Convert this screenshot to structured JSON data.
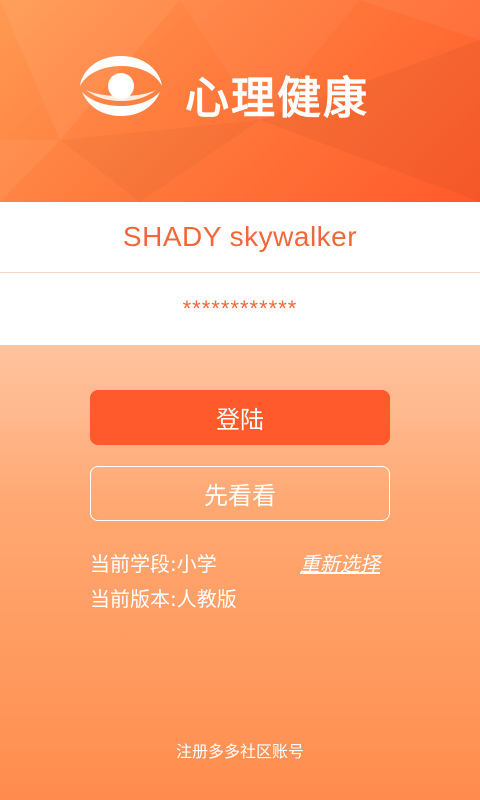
{
  "brand": {
    "name": "心理健康",
    "logo_icon": "eye-ring-logo-icon"
  },
  "form": {
    "username_value": "SHADY skywalker",
    "password_value": "************"
  },
  "actions": {
    "login_label": "登陆",
    "preview_label": "先看看",
    "reselect_label": "重新选择",
    "register_label": "注册多多社区账号"
  },
  "info": {
    "stage": "当前学段:小学",
    "edition": "当前版本:人教版"
  },
  "colors": {
    "accent": "#ff5a2c",
    "header_gradient_start": "#ff9a52",
    "header_gradient_end": "#ff5a2a",
    "input_text": "#f0683a"
  }
}
